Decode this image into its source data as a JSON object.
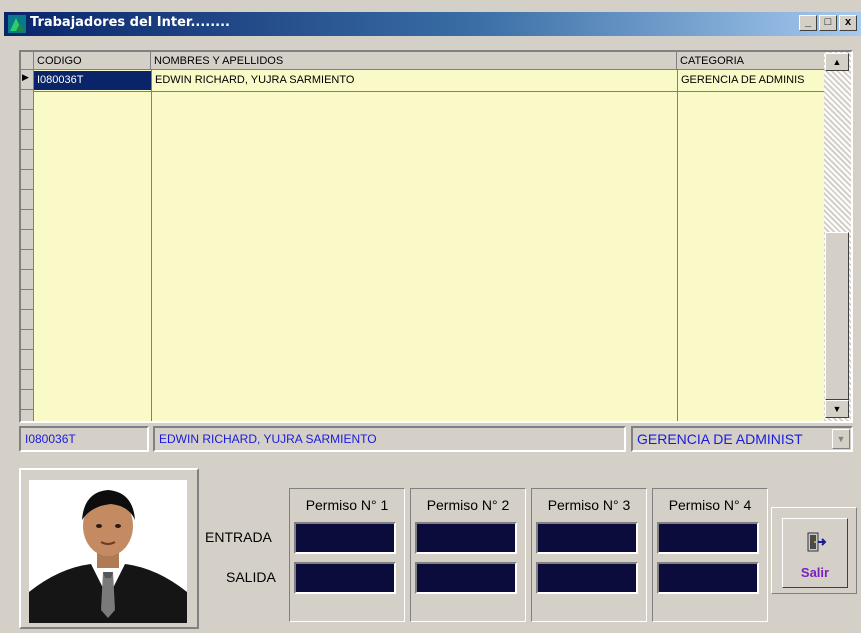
{
  "window": {
    "title": "Trabajadores del  Inter........",
    "controls": {
      "minimize": "_",
      "maximize": "□",
      "close": "x"
    }
  },
  "grid": {
    "columns": [
      "CODIGO",
      "NOMBRES Y APELLIDOS",
      "CATEGORIA"
    ],
    "rows": [
      {
        "codigo": "I080036T",
        "nombres": "EDWIN RICHARD, YUJRA SARMIENTO",
        "categoria": "GERENCIA DE ADMINIS"
      }
    ],
    "current_row_marker": "▶"
  },
  "detail": {
    "codigo": "I080036T",
    "nombres": "EDWIN RICHARD, YUJRA SARMIENTO",
    "categoria": "GERENCIA DE ADMINIST"
  },
  "labels": {
    "entrada": "ENTRADA",
    "salida": "SALIDA"
  },
  "permisos": [
    "Permiso N° 1",
    "Permiso N° 2",
    "Permiso N° 3",
    "Permiso N° 4"
  ],
  "exit_button": {
    "label": "Salir",
    "icon": "door-exit-icon"
  },
  "colors": {
    "grid_bg": "#fafac8",
    "selected_bg": "#0a246a",
    "permiso_box": "#0c0c3c",
    "field_text": "#1a1adc",
    "salir_text": "#7b1fc0"
  }
}
